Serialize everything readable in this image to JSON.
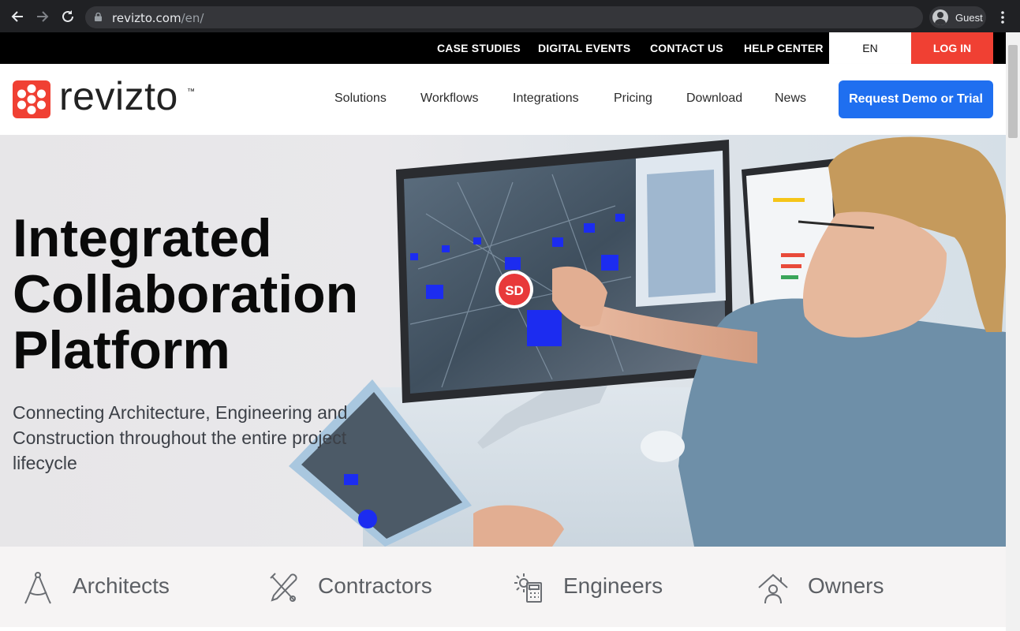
{
  "browser": {
    "url_host": "revizto.com",
    "url_path": "/en/",
    "profile_label": "Guest",
    "icons": [
      "back-arrow-icon",
      "forward-arrow-icon",
      "reload-icon",
      "lock-icon",
      "avatar-icon",
      "menu-dots-icon"
    ]
  },
  "topbar": {
    "links": [
      "CASE STUDIES",
      "DIGITAL EVENTS",
      "CONTACT US",
      "HELP CENTER"
    ],
    "lang": "EN",
    "login": "LOG IN",
    "login_color": "#f04033"
  },
  "header": {
    "brand": "revizto",
    "tm": "™",
    "nav": [
      "Solutions",
      "Workflows",
      "Integrations",
      "Pricing",
      "Download",
      "News"
    ],
    "cta": "Request Demo or Trial",
    "cta_color": "#1f6ff0",
    "logo_color": "#f04033"
  },
  "hero": {
    "title_lines": [
      "Integrated",
      "Collaboration",
      "Platform"
    ],
    "subtitle": "Connecting Architecture, Engineering and Construction throughout the entire project lifecycle",
    "badge": "SD"
  },
  "audiences": [
    {
      "label": "Architects",
      "icon": "compass-icon"
    },
    {
      "label": "Contractors",
      "icon": "tools-icon"
    },
    {
      "label": "Engineers",
      "icon": "gear-calculator-icon"
    },
    {
      "label": "Owners",
      "icon": "house-person-icon"
    }
  ]
}
